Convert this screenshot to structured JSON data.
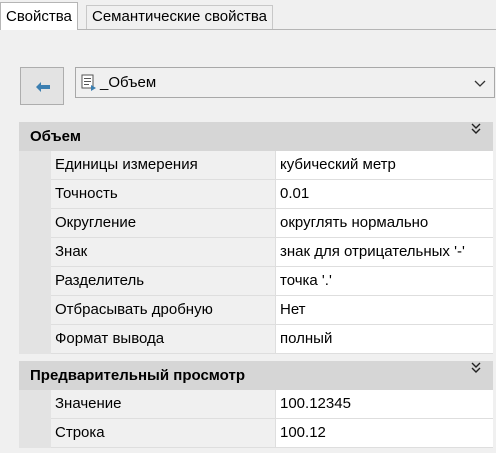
{
  "tabs": [
    {
      "label": "Свойства",
      "active": true
    },
    {
      "label": "Семантические свойства",
      "active": false
    }
  ],
  "toolbar": {
    "back_icon": "arrow-left-icon",
    "combo_icon": "document-icon",
    "combo_value": "_Объем"
  },
  "sections": [
    {
      "title": "Объем",
      "rows": [
        {
          "label": "Единицы измерения",
          "value": "кубический метр"
        },
        {
          "label": "Точность",
          "value": "0.01"
        },
        {
          "label": "Округление",
          "value": "округлять нормально"
        },
        {
          "label": "Знак",
          "value": "знак для отрицательных '-'"
        },
        {
          "label": "Разделитель",
          "value": "точка '.'"
        },
        {
          "label": "Отбрасывать дробную",
          "value": "Нет"
        },
        {
          "label": "Формат вывода",
          "value": "полный"
        }
      ]
    },
    {
      "title": "Предварительный просмотр",
      "rows": [
        {
          "label": "Значение",
          "value": "100.12345"
        },
        {
          "label": "Строка",
          "value": "100.12"
        }
      ]
    }
  ],
  "colors": {
    "accent": "#3c7fb1",
    "section_bg": "#d6d6d6"
  }
}
